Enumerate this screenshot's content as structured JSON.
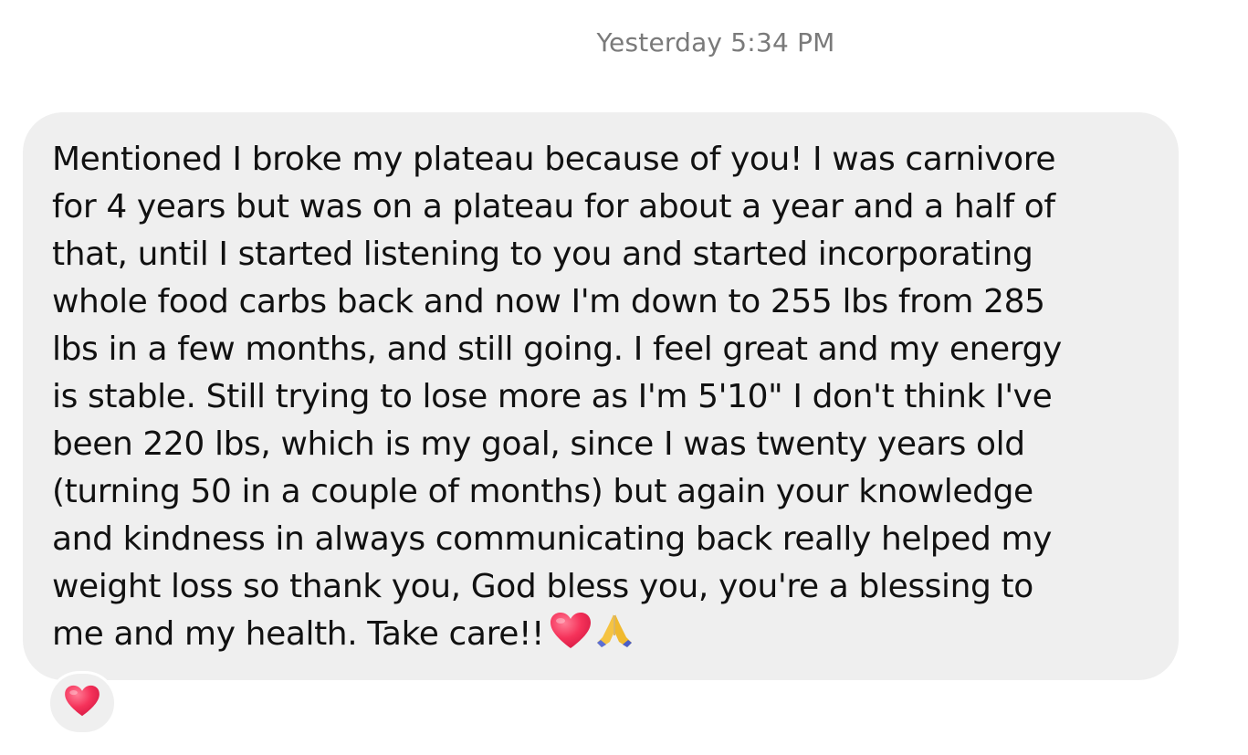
{
  "thread": {
    "timestamp": "Yesterday 5:34 PM"
  },
  "message": {
    "lines": [
      "Mentioned I broke my plateau because of you! I was carnivore",
      "for 4 years but was on a plateau for about a year and a half of",
      "that, until I started listening to you and started incorporating",
      "whole food carbs back and now I'm down to 255 lbs from 285",
      "lbs in a few months, and still going. I feel great and my energy",
      "is stable. Still trying to lose more as I'm 5'10\" I don't think I've",
      "been 220 lbs, which is my goal, since I was twenty years old",
      "(turning 50 in a couple of months) but again your knowledge",
      "and kindness in always communicating back really helped my",
      "weight loss so thank you, God bless you, you're a blessing to",
      "me and my health. Take care!!"
    ],
    "trailing_emojis": [
      "heart-emoji",
      "folded-hands-emoji"
    ]
  },
  "reaction": {
    "emoji": "heart-emoji"
  },
  "colors": {
    "bubble_bg": "#efefef",
    "text": "#111111",
    "timestamp": "#7a7a7a",
    "heart": "#f0325a"
  }
}
